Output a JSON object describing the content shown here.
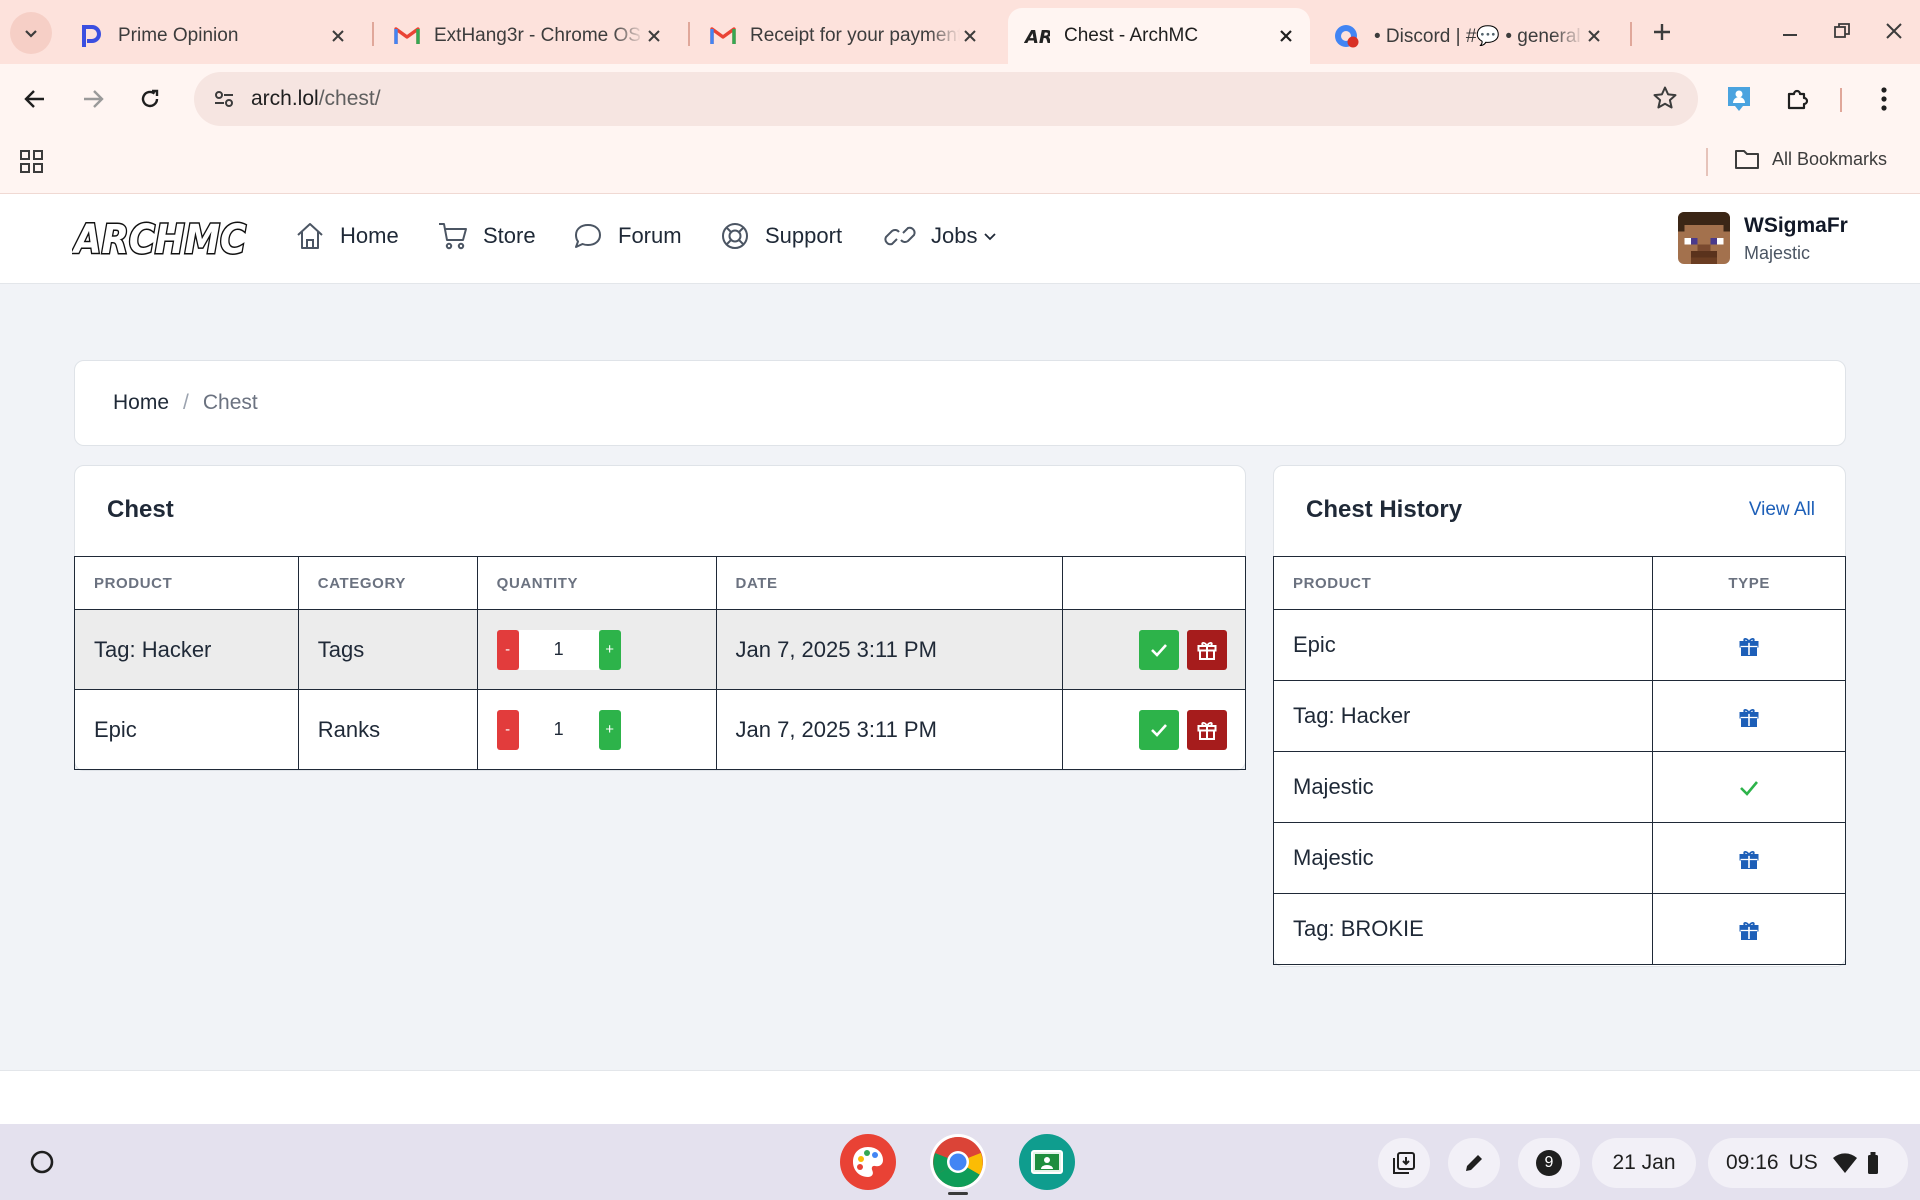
{
  "browser": {
    "tabs": [
      {
        "title": "Prime Opinion",
        "icon": "prime-opinion-icon"
      },
      {
        "title": "ExtHang3r - Chrome OS",
        "icon": "gmail-icon"
      },
      {
        "title": "Receipt for your payment",
        "icon": "gmail-icon"
      },
      {
        "title": "Chest - ArchMC",
        "icon": "archmc-icon",
        "active": true
      },
      {
        "title": "• Discord | #💬 • general",
        "icon": "discord-icon"
      }
    ],
    "url_domain": "arch.lol",
    "url_path": "/chest/",
    "all_bookmarks": "All Bookmarks"
  },
  "site": {
    "logo_text": "ARCHMC",
    "nav": [
      {
        "label": "Home",
        "icon": "home-icon"
      },
      {
        "label": "Store",
        "icon": "cart-icon"
      },
      {
        "label": "Forum",
        "icon": "chat-bubble-icon"
      },
      {
        "label": "Support",
        "icon": "lifebuoy-icon"
      },
      {
        "label": "Jobs",
        "icon": "link-icon"
      }
    ],
    "user": {
      "name": "WSigmaFr",
      "rank": "Majestic"
    }
  },
  "breadcrumb": {
    "home": "Home",
    "separator": "/",
    "current": "Chest"
  },
  "chest": {
    "title": "Chest",
    "columns": [
      "PRODUCT",
      "CATEGORY",
      "QUANTITY",
      "DATE",
      ""
    ],
    "minus_label": "-",
    "plus_label": "+",
    "rows": [
      {
        "product": "Tag: Hacker",
        "category": "Tags",
        "quantity": "1",
        "date": "Jan 7, 2025 3:11 PM"
      },
      {
        "product": "Epic",
        "category": "Ranks",
        "quantity": "1",
        "date": "Jan 7, 2025 3:11 PM"
      }
    ]
  },
  "history": {
    "title": "Chest History",
    "view_all": "View All",
    "columns": [
      "PRODUCT",
      "TYPE"
    ],
    "rows": [
      {
        "product": "Epic",
        "type": "gift-icon"
      },
      {
        "product": "Tag: Hacker",
        "type": "gift-icon"
      },
      {
        "product": "Majestic",
        "type": "check-icon"
      },
      {
        "product": "Majestic",
        "type": "gift-icon"
      },
      {
        "product": "Tag: BROKIE",
        "type": "gift-icon"
      }
    ]
  },
  "shelf": {
    "notification_count": "9",
    "date": "21 Jan",
    "time": "09:16",
    "locale": "US"
  },
  "colors": {
    "accent_blue": "#1d5fb8",
    "claim_green": "#2db34a",
    "gift_red": "#a61c1c",
    "minus_red": "#e23c3c",
    "tab_strip": "#fde2dc"
  }
}
